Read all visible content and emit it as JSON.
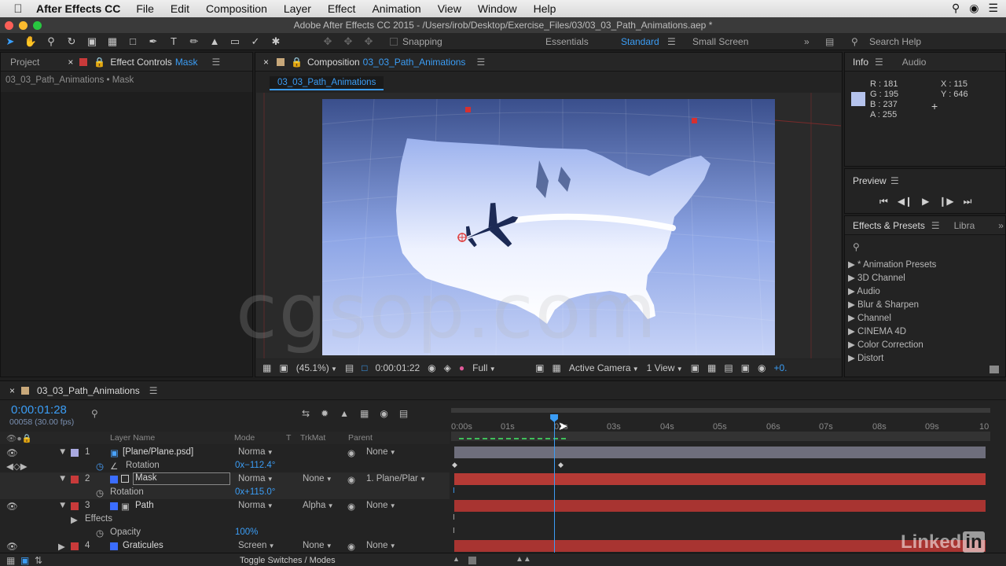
{
  "menubar": {
    "app_name": "After Effects CC",
    "menus": [
      "File",
      "Edit",
      "Composition",
      "Layer",
      "Effect",
      "Animation",
      "View",
      "Window",
      "Help"
    ]
  },
  "window_title": "Adobe After Effects CC 2015 - /Users/irob/Desktop/Exercise_Files/03/03_03_Path_Animations.aep *",
  "toolbar": {
    "snapping_label": "Snapping",
    "workspaces": [
      "Essentials",
      "Standard",
      "Small Screen"
    ],
    "search_label": "Search Help"
  },
  "left_panel": {
    "project_tab": "Project",
    "effect_controls_tab": "Effect Controls",
    "effect_controls_layer": "Mask",
    "breadcrumb": "03_03_Path_Animations • Mask"
  },
  "composition_panel": {
    "tab_prefix": "Composition",
    "comp_name": "03_03_Path_Animations",
    "subtab": "03_03_Path_Animations"
  },
  "comp_footer": {
    "zoom": "(45.1%)",
    "timecode": "0:00:01:22",
    "resolution": "Full",
    "camera": "Active Camera",
    "views": "1 View",
    "exposure": "+0."
  },
  "info_panel": {
    "tabs": [
      "Info",
      "Audio"
    ],
    "r": "R : 181",
    "g": "G : 195",
    "b": "B : 237",
    "a": "A : 255",
    "x": "X : 115",
    "y": "Y : 646",
    "color": "#b5c3ed"
  },
  "preview_panel": {
    "title": "Preview"
  },
  "effects_panel": {
    "tabs": [
      "Effects & Presets",
      "Libra"
    ],
    "search_placeholder": "",
    "items": [
      "* Animation Presets",
      "3D Channel",
      "Audio",
      "Blur & Sharpen",
      "Channel",
      "CINEMA 4D",
      "Color Correction",
      "Distort"
    ]
  },
  "timeline": {
    "comp_tab": "03_03_Path_Animations",
    "timecode": "0:00:01:28",
    "frame_info": "00058 (30.00 fps)",
    "columns": {
      "layer_name": "Layer Name",
      "mode": "Mode",
      "t": "T",
      "trkmat": "TrkMat",
      "parent": "Parent"
    },
    "ruler": [
      "0:00s",
      "01s",
      "02s",
      "03s",
      "04s",
      "05s",
      "06s",
      "07s",
      "08s",
      "09s",
      "10"
    ],
    "playhead_fraction": 0.188,
    "rows": [
      {
        "num": "1",
        "name": "[Plane/Plane.psd]",
        "mode": "Norma",
        "trkmat": "",
        "parent": "None",
        "label_color": "#a9a9e0"
      },
      {
        "sub": "Rotation",
        "value": "0x−112.4°"
      },
      {
        "num": "2",
        "name": "Mask",
        "mode": "Norma",
        "trkmat": "None",
        "parent": "1. Plane/Plar",
        "label_color": "#c83a3a"
      },
      {
        "sub": "Rotation",
        "value": "0x+115.0°"
      },
      {
        "num": "3",
        "name": "Path",
        "mode": "Norma",
        "trkmat": "Alpha",
        "parent": "None",
        "label_color": "#c83a3a"
      },
      {
        "sub": "Effects",
        "value": ""
      },
      {
        "sub": "Opacity",
        "value": "100%"
      },
      {
        "num": "4",
        "name": "Graticules",
        "mode": "Screen",
        "trkmat": "None",
        "parent": "None",
        "label_color": "#c83a3a"
      }
    ],
    "toggle_label": "Toggle Switches / Modes"
  },
  "watermark": "cgsop.com",
  "linkedin": "Linked"
}
